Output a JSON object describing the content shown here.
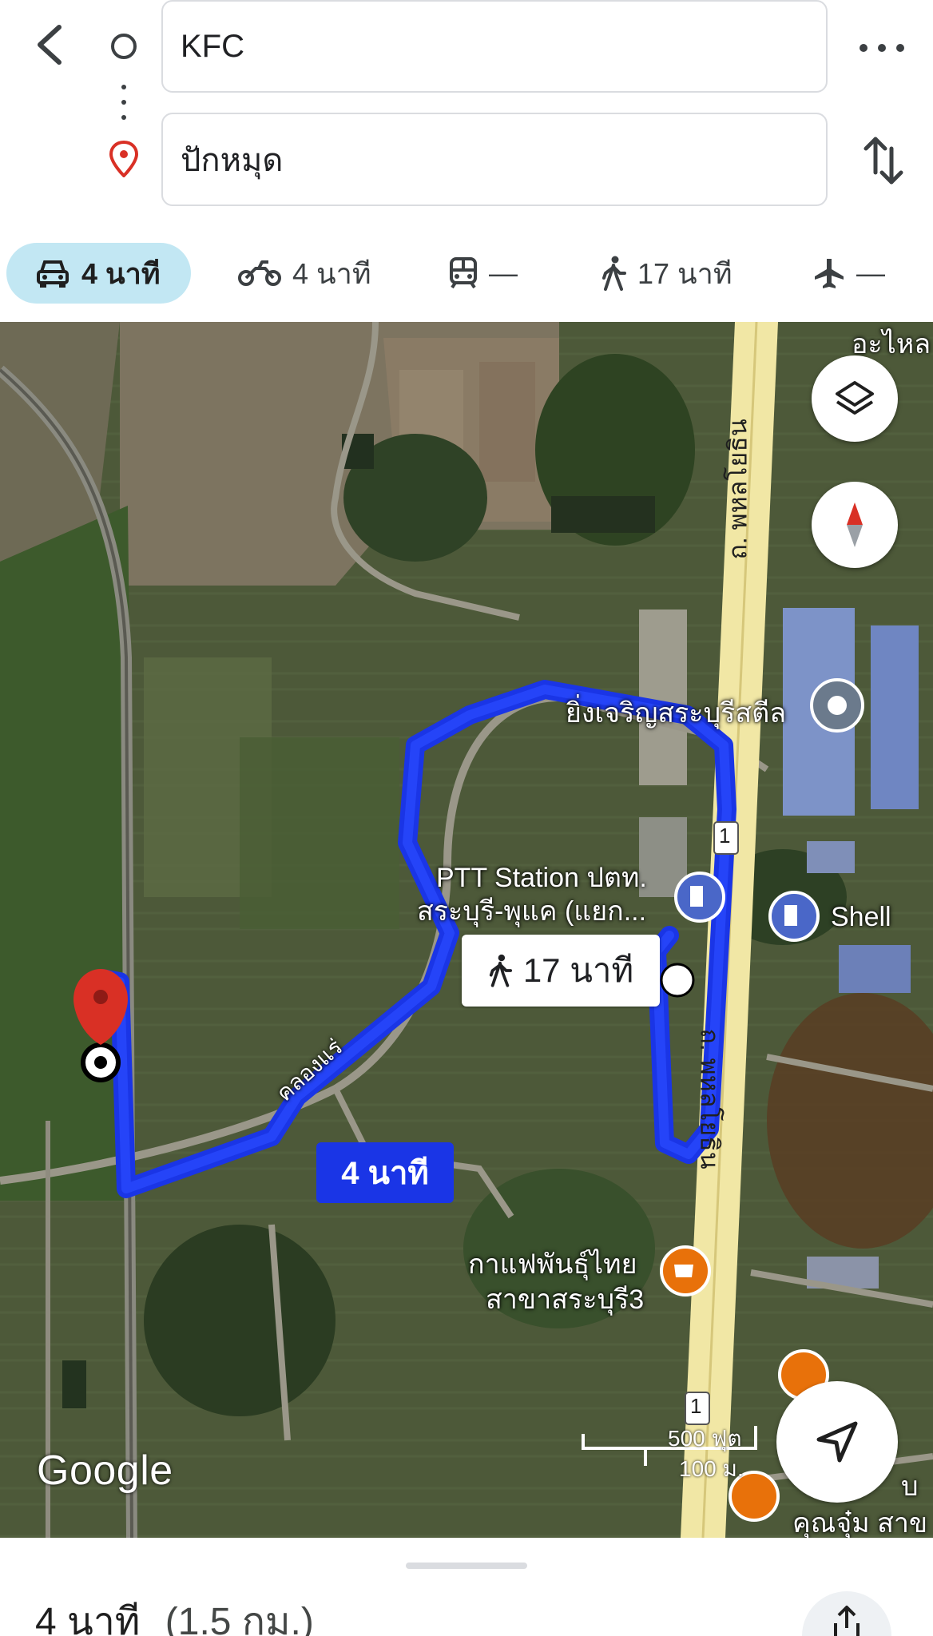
{
  "search": {
    "origin_value": "KFC",
    "destination_value": "ปักหมุด"
  },
  "modes": [
    {
      "name": "drive",
      "icon": "car-icon",
      "label": "4 นาที",
      "active": true
    },
    {
      "name": "motorcycle",
      "icon": "motorcycle-icon",
      "label": "4 นาที",
      "active": false
    },
    {
      "name": "transit",
      "icon": "train-icon",
      "label": "—",
      "active": false
    },
    {
      "name": "walk",
      "icon": "walking-icon",
      "label": "17 นาที",
      "active": false
    },
    {
      "name": "flight",
      "icon": "airplane-icon",
      "label": "—",
      "active": false
    }
  ],
  "map": {
    "labels": {
      "place_top_right": "อะไหล",
      "steel_company": "ยิ่งเจริญสระบุรีสตีล",
      "ptt_station_line1": "PTT Station ปตท.",
      "ptt_station_line2": "สระบุรี-พุแค (แยก...",
      "shell": "Shell",
      "cafe_line1": "กาแฟพันธุ์ไทย",
      "cafe_line2": "สาขาสระบุรี3",
      "bottom_right_line1": "บ",
      "bottom_right_line2": "คุณจุ๋ม สาข",
      "canal": "คลองแร่",
      "highway_upper": "ถ. พหลโยธิน",
      "highway_lower": "ถ. พหลโยธิน",
      "route_shield_1": "1",
      "route_shield_2": "1"
    },
    "walk_callout": "17 นาที",
    "drive_callout": "4 นาที",
    "attribution": "Google",
    "scale_ft": "500 ฟุต",
    "scale_m": "100 ม."
  },
  "summary": {
    "time": "4 นาที",
    "distance": "(1.5 กม.)"
  },
  "colors": {
    "route": "#1a35e6",
    "active_mode_bg": "#c2e7f3",
    "pin_red": "#d93025",
    "poi_blue": "#4a67c8",
    "poi_orange": "#e8710a"
  }
}
